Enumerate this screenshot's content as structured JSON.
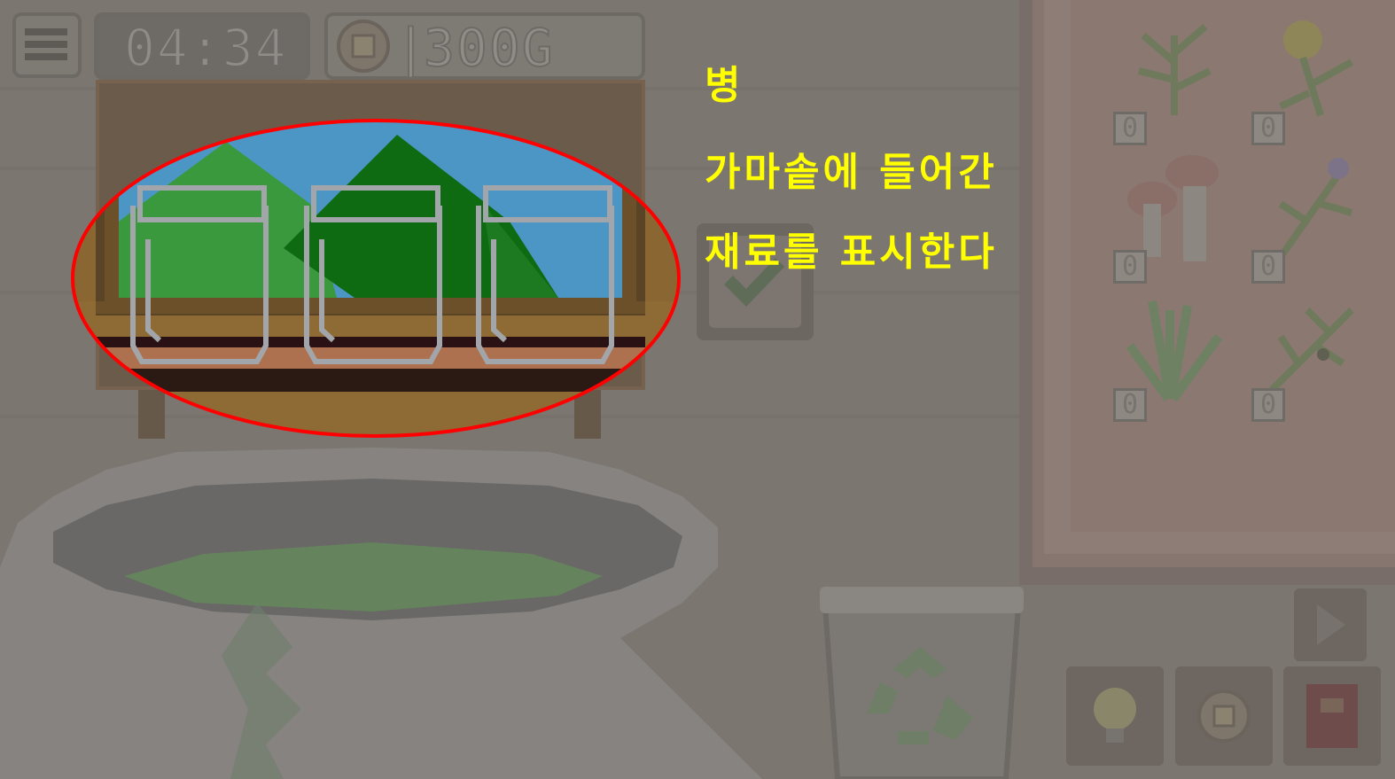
{
  "hud": {
    "menu_icon": "hamburger-menu-icon",
    "timer": "04:34",
    "gold": "300G",
    "coin_icon": "gold-coin-icon"
  },
  "annotation": {
    "line1": "병",
    "line2": "가마솥에 들어간",
    "line3": "재료를 표시한다",
    "highlight_color": "#ff0000",
    "text_color": "#ffff00"
  },
  "inventory": {
    "items": [
      {
        "icon": "herb-green-icon",
        "count": "0"
      },
      {
        "icon": "flower-yellow-icon",
        "count": "0"
      },
      {
        "icon": "mushroom-icon",
        "count": "0"
      },
      {
        "icon": "lavender-icon",
        "count": "0"
      },
      {
        "icon": "aloe-icon",
        "count": "0"
      },
      {
        "icon": "olive-branch-icon",
        "count": "0"
      }
    ]
  },
  "controls": {
    "confirm_icon": "checkmark-icon",
    "play_icon": "play-arrow-icon",
    "hint_icon": "lightbulb-icon",
    "shop_icon": "coin-shop-icon",
    "book_icon": "recipe-book-icon",
    "trash_icon": "recycle-bin-icon"
  },
  "colors": {
    "sky": "#4b96c4",
    "mountain_light": "#3a983d",
    "mountain_dark": "#0e6b12",
    "shelf": "#8e6a35"
  }
}
